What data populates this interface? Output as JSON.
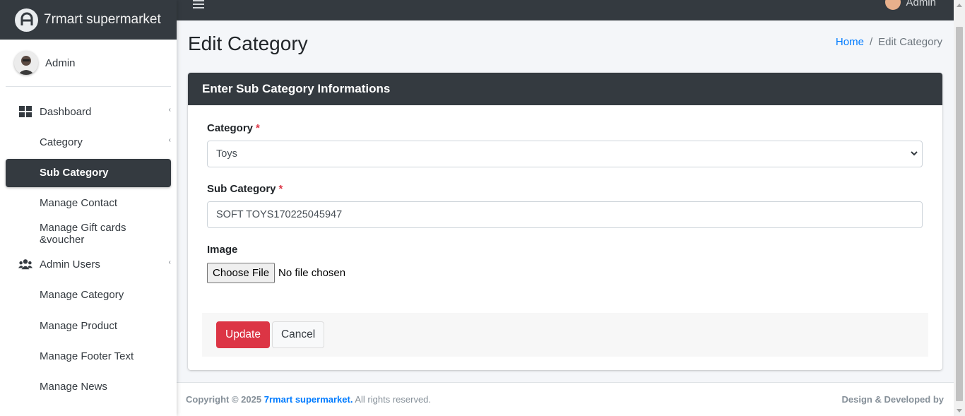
{
  "brand": {
    "name": "7rmart supermarket"
  },
  "user": {
    "name": "Admin"
  },
  "topbar": {
    "user_name": "Admin"
  },
  "sidebar": {
    "items": [
      {
        "label": "Dashboard"
      },
      {
        "label": "Category"
      },
      {
        "label": "Sub Category"
      },
      {
        "label": "Manage Contact"
      },
      {
        "label": "Manage Gift cards &voucher"
      },
      {
        "label": "Admin Users"
      },
      {
        "label": "Manage Category"
      },
      {
        "label": "Manage Product"
      },
      {
        "label": "Manage Footer Text"
      },
      {
        "label": "Manage News"
      }
    ]
  },
  "page": {
    "title": "Edit Category",
    "breadcrumb": {
      "home": "Home",
      "separator": "/",
      "current": "Edit Category"
    }
  },
  "form": {
    "header": "Enter Sub Category Informations",
    "category": {
      "label": "Category",
      "required_mark": "*",
      "value": "Toys"
    },
    "subcategory": {
      "label": "Sub Category",
      "required_mark": "*",
      "value": "SOFT TOYS170225045947"
    },
    "image": {
      "label": "Image",
      "button": "Choose File",
      "status": "No file chosen"
    },
    "update_label": "Update",
    "cancel_label": "Cancel"
  },
  "footer": {
    "copyright_prefix": "Copyright © 2025",
    "brand_link": "7rmart supermarket.",
    "rights": "All rights reserved.",
    "right_text": "Design & Developed by"
  },
  "colors": {
    "dark": "#343a40",
    "accent": "#dc3545",
    "link": "#007bff"
  }
}
